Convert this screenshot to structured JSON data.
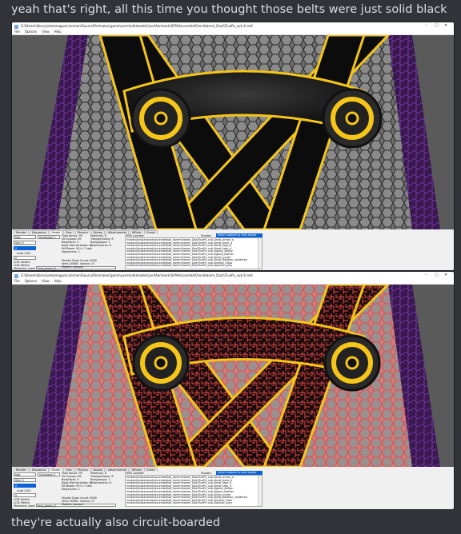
{
  "messages": {
    "top": "yeah that's right, all this time you thought those belts were just solid black",
    "bottom": "they're actually also circuit-boarded"
  },
  "window": {
    "title": "E:\\Steam\\library\\steamapps\\common\\SourceFilmmaker\\game\\usermod\\models\\LordAardvark\\SFM\\Ascended\\OmniHarem_Daz\\\\TruePx_sub.4.mdl",
    "controls": [
      "–",
      "▢",
      "✕"
    ],
    "menu": [
      "File",
      "Options",
      "View",
      "Help"
    ]
  },
  "panel": {
    "tabs": [
      "Render",
      "Sequence",
      "Model",
      "Flex",
      "Physics",
      "Bones",
      "Attachments",
      "IKRule",
      "Event"
    ],
    "active_tab": "Model",
    "body_value": "fast",
    "submodel_value": "Submodel 1",
    "skin_value": "Skin 0",
    "auto_lod_label": "Auto LOD",
    "lod_value": "0",
    "lod_switch_label": "LOD Switch",
    "lod_switch_value": "0",
    "lod_metric_label": "LOD Metric:",
    "lod_metric_value": "0",
    "materials_label": "Materials used:",
    "materials_value": "Suit_Jamie_D",
    "stats_col1": "Total bones: 99\nHit Groups: 89\nBodyParts: 9\nBody Mat Variables: 8\nHit Boxes: 90 in 7 sets\nSequences: 1\n\n\nShader Draw Count: 6000\nVerts 30368  Indices: 27\nModels: opaque",
    "stats_col2": "Materials: 8\nTriangle/Strips: 8\nBodygroups: 1\nAttachments: 6",
    "vmt_label": "VMTs Loaded:",
    "shader_label": "Shader:",
    "shader_value": "Select material to view shader",
    "materials_list": [
      "models\\lordaardvark\\ascended\\ab_harem\\harem_Daz\\TruePx_sub.4\\mat_armor_a",
      "models\\lordaardvark\\ascended\\ab_harem\\harem_Daz\\TruePx_sub.4\\mat_body_a",
      "models\\lordaardvark\\ascended\\ab_harem\\harem_Daz\\TruePx_sub.4\\mat_legs_b",
      "models\\lordaardvark\\ascended\\ab_harem\\harem_Daz\\TruePx_sub.4\\mat_legs_d",
      "models\\lordaardvark\\ascended\\ab_harem\\harem_Daz\\TruePx_sub.4\\glass_yellow",
      "models\\lordaardvark\\ascended\\ab_harem\\harem_Daz\\TruePx_sub.4\\glass_leather",
      "models\\lordaardvark\\ascended\\ab_harem\\harem_Daz\\TruePx_sub.4\\skin_cyclet",
      "models\\lordaardvark\\ascended\\ab_harem\\harem_Daz\\TruePx_sub.4\\mat_Bellawn_unaltered",
      "models\\lordaardvark\\ascended\\ab_harem\\harem_Daz\\TruePx_sub.4\\metal_Glass",
      "models\\lordaardvark\\ascended\\ab_harem\\harem_Daz\\TruePx_sub.4\\plastic_grey",
      "models\\lordaardvark\\ascended\\ab_harem\\harem_Daz\\TruePx_sub.4\\glass_pending",
      "models\\lordaardvark\\ascended\\ab_harem\\harem_Daz\\TruePx_sub.4\\mat_armor_subdeta",
      "models\\lordaardvark\\ascended\\ab_harem\\harem_Daz\\TruePx_sub.4\\mat_body_subdeta"
    ],
    "frame_label": "Frame:",
    "frame_value": "0.0"
  },
  "colors": {
    "discord_bg": "#313338",
    "belt_gold": "#f5c518",
    "belt_black": "#0c0c0c",
    "circuit_red": "#e84a4a",
    "hex_gray": "#7a7a7a",
    "purple_side": "#5a2a7a"
  }
}
